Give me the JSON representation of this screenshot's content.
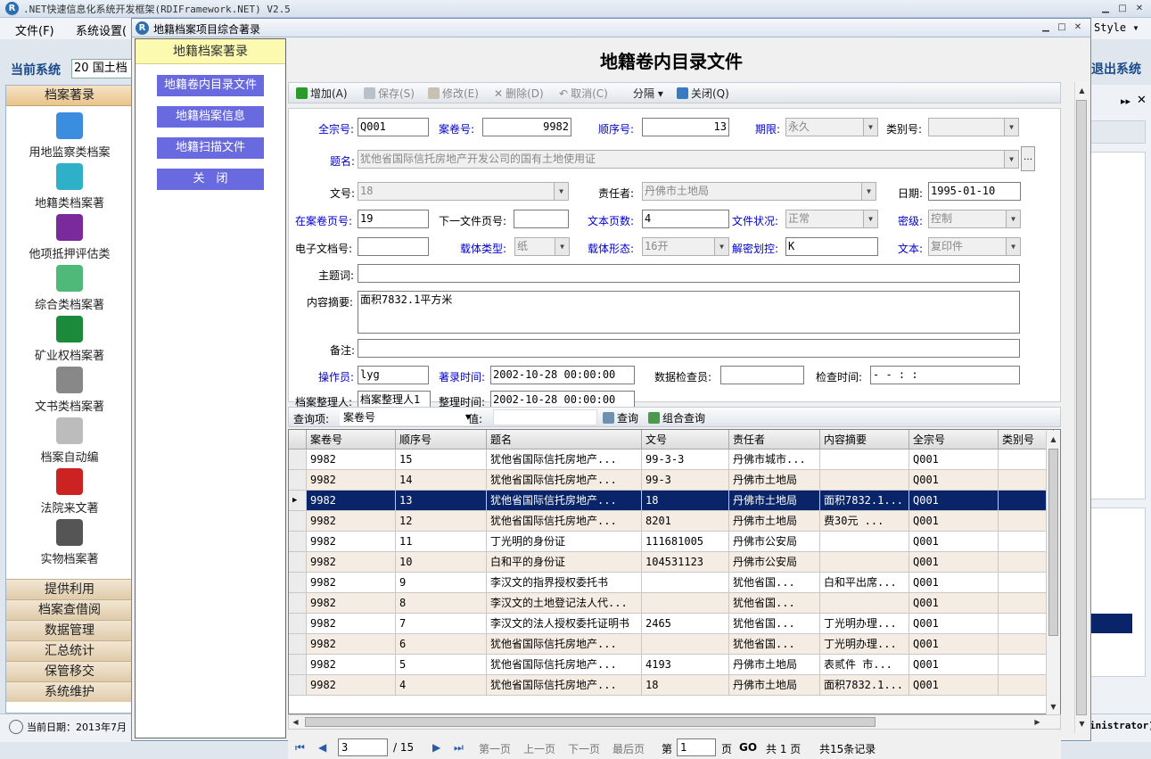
{
  "app": {
    "title": ".NET快速信息化系统开发框架(RDIFramework.NET) V2.5",
    "style_label": "Style"
  },
  "menu": [
    "文件(F)",
    "系统设置("
  ],
  "system": {
    "label": "当前系统",
    "value": "20",
    "value2": "国土档"
  },
  "exit_label": "退出系统",
  "admin_text": "inistrator)",
  "sidebar": {
    "group_title": "档案著录",
    "items": [
      {
        "label": "用地监察类档案",
        "icon": "monitor-icon",
        "color": "#3b8de0"
      },
      {
        "label": "地籍类档案著",
        "icon": "book-icon",
        "color": "#2fb0c9"
      },
      {
        "label": "他项抵押评估类",
        "icon": "purple-box-icon",
        "color": "#7a2a9a"
      },
      {
        "label": "综合类档案著",
        "icon": "panel-icon",
        "color": "#4fb97a"
      },
      {
        "label": "矿业权档案著",
        "icon": "su-icon",
        "color": "#1b8a3a"
      },
      {
        "label": "文书类档案著",
        "icon": "phone-icon",
        "color": "#888888"
      },
      {
        "label": "档案自动编",
        "icon": "pen-icon",
        "color": "#bcbcbc"
      },
      {
        "label": "法院来文著",
        "icon": "mail-icon",
        "color": "#cc2222"
      },
      {
        "label": "实物档案著",
        "icon": "film-icon",
        "color": "#555555"
      }
    ],
    "footer_groups": [
      "提供利用",
      "档案查借阅",
      "数据管理",
      "汇总统计",
      "保管移交",
      "系统维护"
    ]
  },
  "status": {
    "date": "当前日期：2013年7月"
  },
  "dialog": {
    "title": "地籍档案项目综合著录",
    "left_header": "地籍档案著录",
    "nav": [
      "地籍卷内目录文件",
      "地籍档案信息",
      "地籍扫描文件",
      "关　闭"
    ],
    "heading": "地籍卷内目录文件",
    "toolbar": {
      "add": "增加(A)",
      "save": "保存(S)",
      "edit": "修改(E)",
      "delete": "删除(D)",
      "cancel": "取消(C)",
      "split": "分隔",
      "close": "关闭(Q)"
    },
    "form": {
      "qzh_label": "全宗号:",
      "qzh": "Q001",
      "ajh_label": "案卷号:",
      "ajh": "9982",
      "sxh_label": "顺序号:",
      "sxh": "13",
      "qx_label": "期限:",
      "qx": "永久",
      "lbh_label": "类别号:",
      "lbh": "",
      "tm_label": "题名:",
      "tm": "犹他省国际信托房地产开发公司的国有土地使用证",
      "wh_label": "文号:",
      "wh": "18",
      "zrz_label": "责任者:",
      "zrz": "丹佛市土地局",
      "rq_label": "日期:",
      "rq": "1995-01-10",
      "zajyh_label": "在案卷页号:",
      "zajyh": "19",
      "xyyh_label": "下一文件页号:",
      "xyyh": "",
      "wbys_label": "文本页数:",
      "wbys": "4",
      "wjzk_label": "文件状况:",
      "wjzk": "正常",
      "mj_label": "密级:",
      "mj": "控制",
      "dzwdh_label": "电子文档号:",
      "dzwdh": "",
      "ztlx_label": "载体类型:",
      "ztlx": "纸",
      "ztxt_label": "载体形态:",
      "ztxt": "16开",
      "jmhk_label": "解密划控:",
      "jmhk": "K",
      "wb_label": "文本:",
      "wb": "复印件",
      "ztc_label": "主题词:",
      "ztc": "",
      "nrzy_label": "内容摘要:",
      "nrzy": "面积7832.1平方米",
      "bz_label": "备注:",
      "bz": "",
      "czy_label": "操作员:",
      "czy": "lyg",
      "zlsj_label": "著录时间:",
      "zlsj": "2002-10-28 00:00:00",
      "sjjcy_label": "数据检查员:",
      "sjjcy": "",
      "jcsj_label": "检查时间:",
      "jcsj": "  -  -     :  :",
      "dazlr_label": "档案整理人:",
      "dazlr": "档案整理人1",
      "zlsj2_label": "整理时间:",
      "zlsj2": "2002-10-28 00:00:00"
    },
    "query": {
      "label": "查询项:",
      "field": "案卷号",
      "value_label": "值:",
      "value": "",
      "search": "查询",
      "combo": "组合查询"
    },
    "grid": {
      "columns": [
        "案卷号",
        "顺序号",
        "题名",
        "文号",
        "责任者",
        "内容摘要",
        "全宗号",
        "类别号"
      ],
      "rows": [
        [
          "9982",
          "15",
          "  犹他省国际信托房地产...",
          "99-3-3",
          "丹佛市城市...",
          "",
          "Q001",
          ""
        ],
        [
          "9982",
          "14",
          "  犹他省国际信托房地产...",
          "99-3",
          "丹佛市土地局",
          "",
          "Q001",
          ""
        ],
        [
          "9982",
          "13",
          "  犹他省国际信托房地产...",
          "18",
          "丹佛市土地局",
          "面积7832.1...",
          "Q001",
          ""
        ],
        [
          "9982",
          "12",
          "  犹他省国际信托房地产...",
          "8201",
          "丹佛市土地局",
          "费30元   ...",
          "Q001",
          ""
        ],
        [
          "9982",
          "11",
          "丁光明的身份证",
          "111681005",
          "丹佛市公安局",
          "",
          "Q001",
          ""
        ],
        [
          "9982",
          "10",
          "白和平的身份证",
          "104531123",
          "丹佛市公安局",
          "",
          "Q001",
          ""
        ],
        [
          "9982",
          "9",
          "李汉文的指界授权委托书",
          "",
          "  犹他省国...",
          "白和平出席...",
          "Q001",
          ""
        ],
        [
          "9982",
          "8",
          "李汉文的土地登记法人代...",
          "",
          "  犹他省国...",
          "",
          "Q001",
          ""
        ],
        [
          "9982",
          "7",
          "李汉文的法人授权委托证明书",
          "2465",
          "  犹他省国...",
          "丁光明办理...",
          "Q001",
          ""
        ],
        [
          "9982",
          "6",
          "  犹他省国际信托房地产...",
          "",
          "  犹他省国...",
          "丁光明办理...",
          "Q001",
          ""
        ],
        [
          "9982",
          "5",
          "  犹他省国际信托房地产...",
          "4193",
          "丹佛市土地局",
          "表贰件  市...",
          "Q001",
          ""
        ],
        [
          "9982",
          "4",
          "  犹他省国际信托房地产...",
          "18",
          "丹佛市土地局",
          "面积7832.1...",
          "Q001",
          ""
        ]
      ],
      "selected_row": 2
    },
    "pager": {
      "page": "3",
      "total": "/ 15",
      "first": "第一页",
      "prev": "上一页",
      "next": "下一页",
      "last": "最后页",
      "goto_pre": "第",
      "goto_val": "1",
      "goto_post": "页",
      "go": "GO",
      "total_pages": "共 1 页",
      "total_records": "共15条记录"
    }
  }
}
